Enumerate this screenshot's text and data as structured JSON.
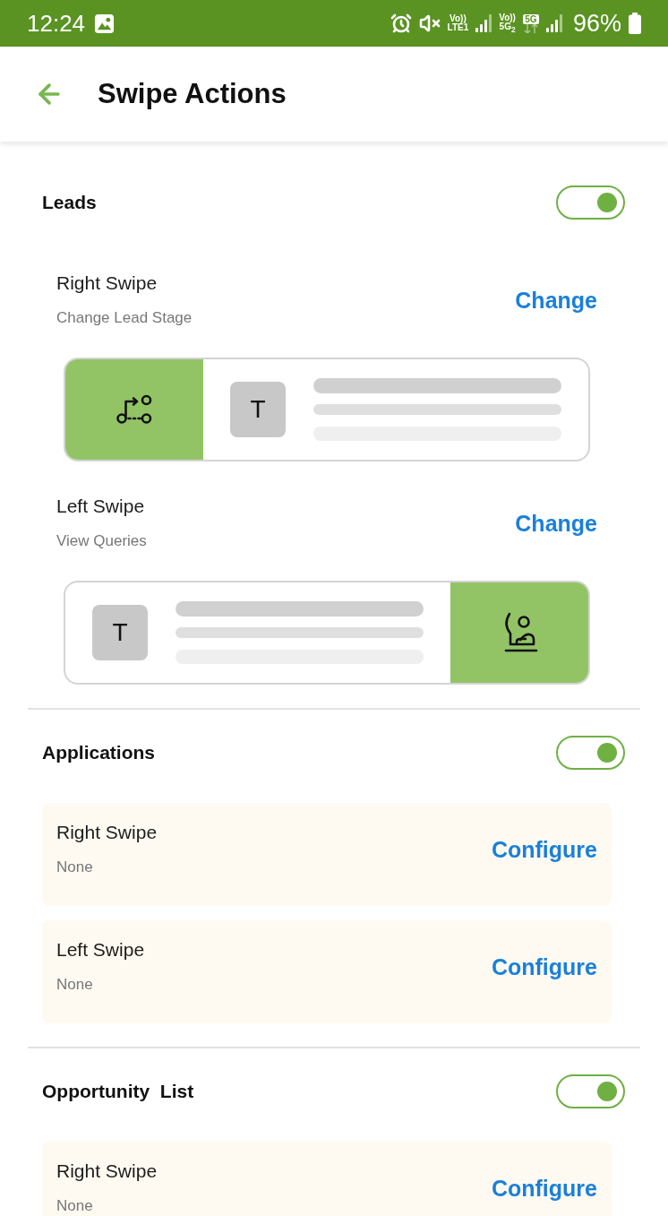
{
  "status_bar": {
    "time": "12:24",
    "sims": [
      {
        "voice": "Vo))",
        "network": "LTE1"
      },
      {
        "voice": "Vo))",
        "network": "5G$_{2}$",
        "data_badge": "5G"
      }
    ],
    "battery": "96%"
  },
  "app_bar": {
    "title": "Swipe Actions"
  },
  "sections": [
    {
      "title": "Leads",
      "on": true,
      "swipes": [
        {
          "kind": "preview",
          "panel_left": true,
          "label": "Right Swipe",
          "action": "Change Lead Stage",
          "button": "Change",
          "avatar": "T"
        },
        {
          "kind": "preview",
          "panel_left": false,
          "label": "Left Swipe",
          "action": "View Queries",
          "button": "Change",
          "avatar": "T"
        }
      ]
    },
    {
      "title": "Applications",
      "on": true,
      "swipes": [
        {
          "kind": "config",
          "label": "Right Swipe",
          "action": "None",
          "button": "Configure"
        },
        {
          "kind": "config",
          "label": "Left Swipe",
          "action": "None",
          "button": "Configure"
        }
      ]
    },
    {
      "title": "Opportunity  List",
      "on": true,
      "swipes": [
        {
          "kind": "config",
          "label": "Right Swipe",
          "action": "None",
          "button": "Configure"
        }
      ]
    }
  ]
}
